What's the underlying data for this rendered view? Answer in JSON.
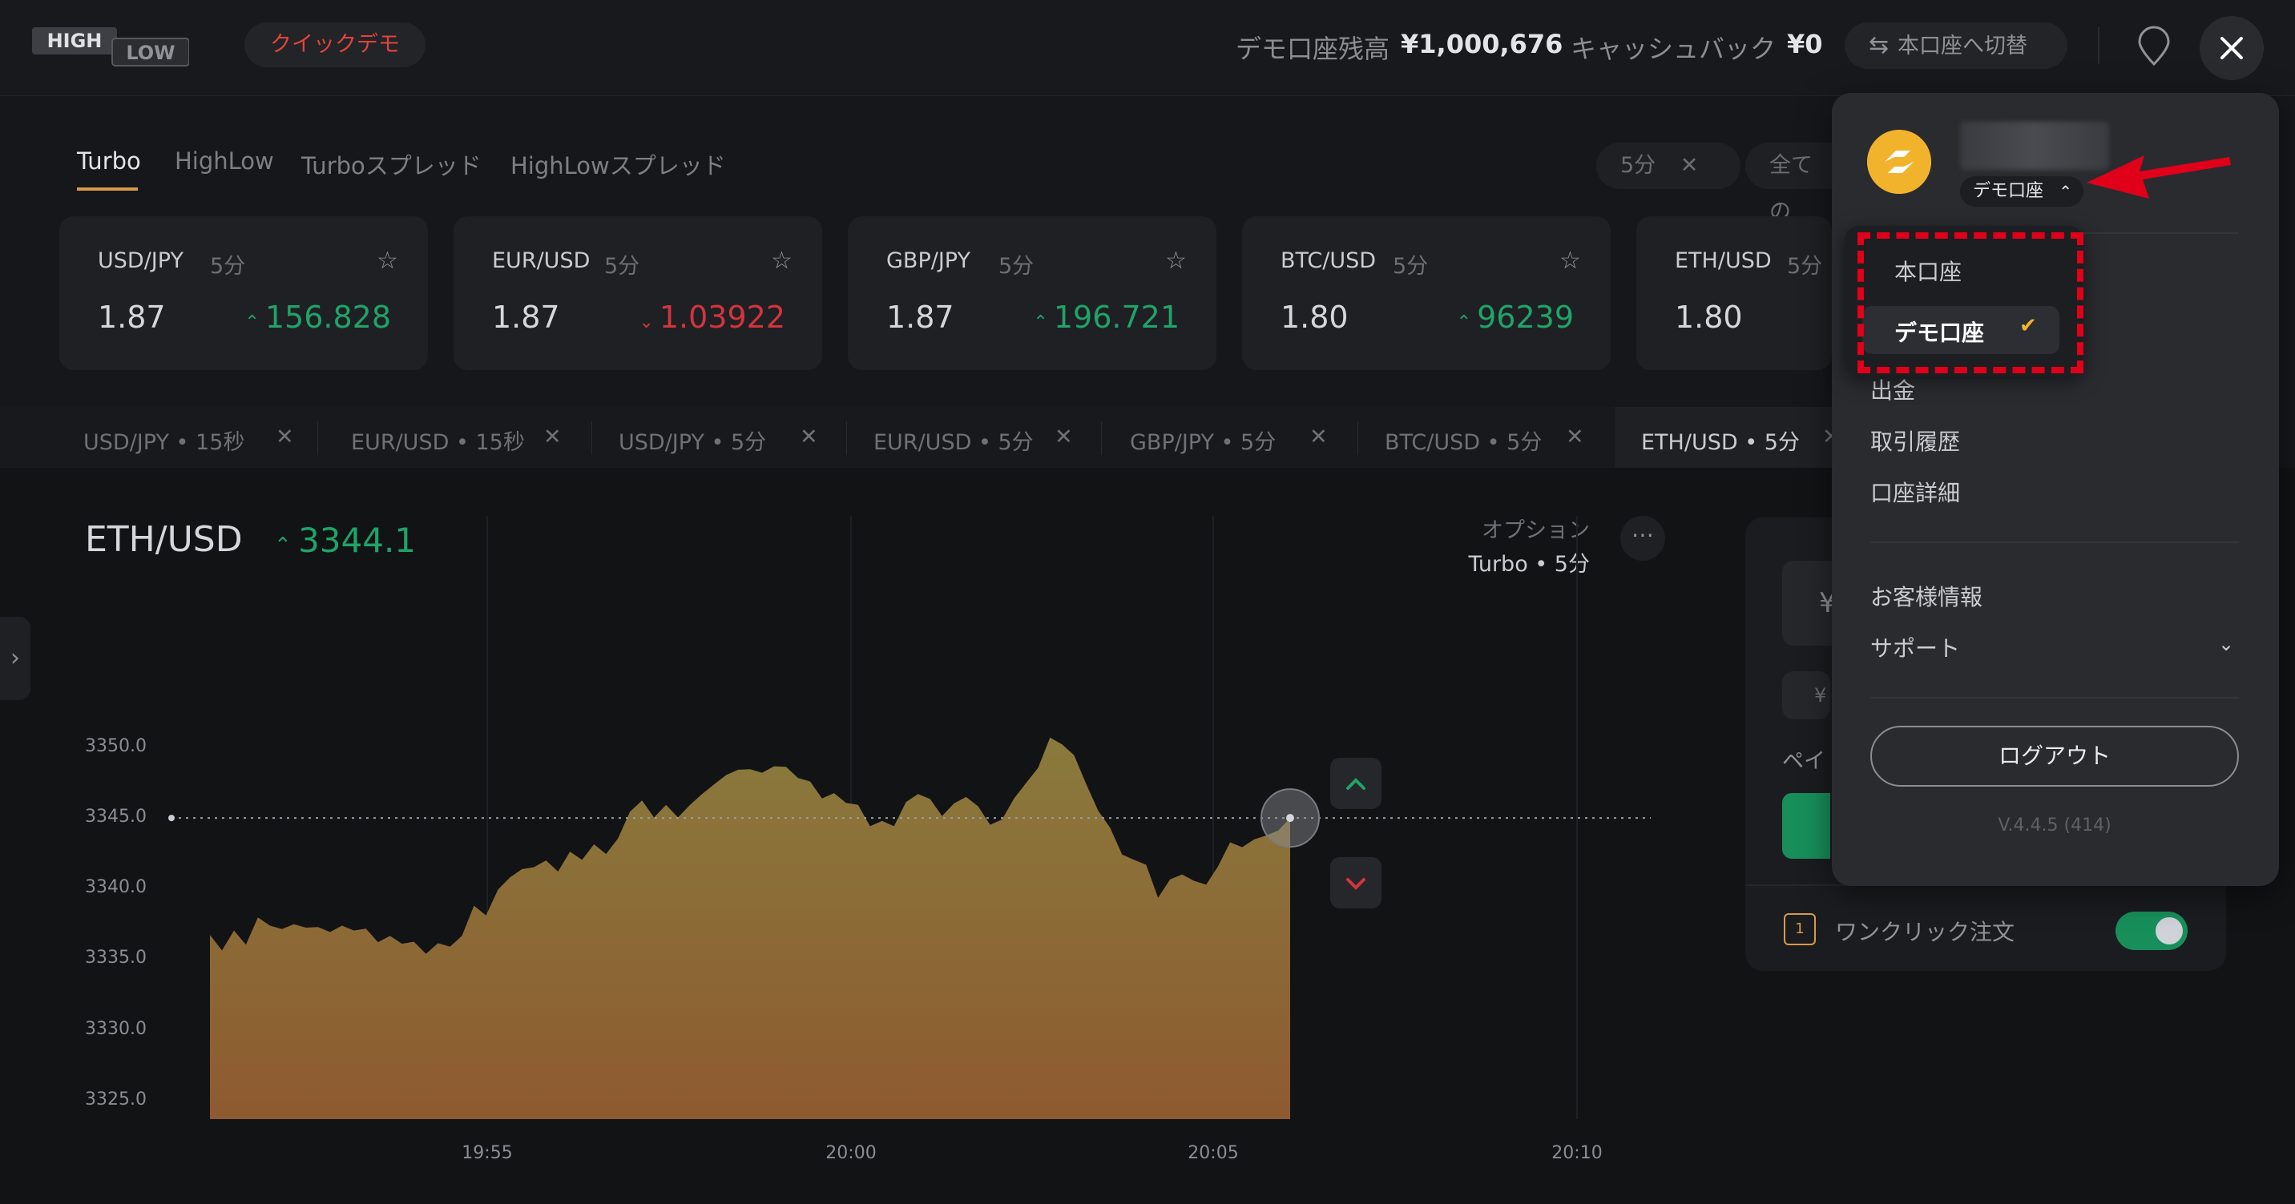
{
  "header": {
    "logo_top": "HIGH",
    "logo_bottom": "LOW",
    "quick_demo": "クイックデモ",
    "balance_label": "デモ口座残高",
    "balance_value": "¥1,000,676",
    "cashback_label": "キャッシュバック",
    "cashback_value": "¥0",
    "switch_label": "本口座へ切替",
    "icons": {
      "switch": "swap-arrows-icon",
      "pin": "location-pin-icon",
      "close": "close-icon"
    }
  },
  "product_tabs": [
    "Turbo",
    "HighLow",
    "Turboスプレッド",
    "HighLowスプレッド"
  ],
  "filters": {
    "duration": "5分",
    "all": "全ての"
  },
  "asset_cards": [
    {
      "pair": "USD/JPY",
      "duration": "5分",
      "payout": "1.87",
      "price": "156.828",
      "direction": "up"
    },
    {
      "pair": "EUR/USD",
      "duration": "5分",
      "payout": "1.87",
      "price": "1.03922",
      "direction": "down"
    },
    {
      "pair": "GBP/JPY",
      "duration": "5分",
      "payout": "1.87",
      "price": "196.721",
      "direction": "up"
    },
    {
      "pair": "BTC/USD",
      "duration": "5分",
      "payout": "1.80",
      "price": "96239",
      "direction": "up"
    },
    {
      "pair": "ETH/USD",
      "duration": "5分",
      "payout": "1.80",
      "price": "",
      "direction": "up"
    }
  ],
  "chart_tabs": [
    "USD/JPY • 15秒",
    "EUR/USD • 15秒",
    "USD/JPY • 5分",
    "EUR/USD • 5分",
    "GBP/JPY • 5分",
    "BTC/USD • 5分",
    "ETH/USD • 5分"
  ],
  "chart_header": {
    "title": "ETH/USD",
    "price": "3344.1",
    "option_label": "オプション",
    "option_value": "Turbo • 5分",
    "more": "⋯"
  },
  "chart_data": {
    "type": "area",
    "x_ticks": [
      "19:55",
      "20:00",
      "20:05",
      "20:10"
    ],
    "y_ticks": [
      "3350.0",
      "3345.0",
      "3340.0",
      "3335.0",
      "3330.0",
      "3325.0"
    ],
    "ylim": [
      3323.5,
      3352
    ],
    "current_price": 3344.1,
    "fill_top": "#8a7a3c",
    "fill_bottom": "#8e5a30",
    "values": [
      3336.1,
      3335.2,
      3336.4,
      3335.6,
      3337.3,
      3336.9,
      3336.5,
      3337.0,
      3336.6,
      3336.8,
      3336.3,
      3336.9,
      3336.4,
      3336.7,
      3335.6,
      3336.2,
      3335.5,
      3335.8,
      3334.8,
      3335.7,
      3335.3,
      3336.2,
      3338.1,
      3337.6,
      3339.2,
      3340.2,
      3340.6,
      3340.9,
      3341.2,
      3340.6,
      3341.8,
      3341.4,
      3342.3,
      3341.8,
      3342.7,
      3344.7,
      3345.3,
      3344.3,
      3345.0,
      3344.3,
      3345.0,
      3345.9,
      3346.4,
      3347.2,
      3347.4,
      3347.6,
      3347.2,
      3347.8,
      3347.6,
      3347.0,
      3346.6,
      3345.6,
      3345.8,
      3345.3,
      3345.0,
      3343.7,
      3343.9,
      3343.7,
      3345.2,
      3345.9,
      3345.4,
      3344.4,
      3345.1,
      3345.7,
      3344.9,
      3343.8,
      3344.0,
      3345.6,
      3346.5,
      3347.7,
      3349.6,
      3349.3,
      3348.4,
      3346.6,
      3344.6,
      3343.6,
      3341.6,
      3341.4,
      3340.9,
      3338.8,
      3339.9,
      3340.4,
      3339.8,
      3339.7,
      3340.8,
      3342.6,
      3342.1,
      3342.8,
      3342.9,
      3343.4,
      3344.1
    ],
    "buttons": {
      "up": "chevron-up-icon",
      "down": "chevron-down-icon"
    }
  },
  "trade_panel": {
    "amount_prefix": "¥",
    "small_prefix": "¥",
    "payout_label": "ペイ",
    "oneclick_label": "ワンクリック注文",
    "oneclick_icon": "1"
  },
  "account_menu": {
    "account_type": "デモ口座",
    "dropdown_options": [
      "本口座",
      "デモ口座"
    ],
    "selected_option": "デモ口座",
    "items": [
      "出金",
      "取引履歴",
      "口座詳細",
      "お客様情報",
      "サポート"
    ],
    "logout": "ログアウト",
    "version": "V.4.4.5 (414)"
  },
  "colors": {
    "accent": "#d89b47",
    "up": "#1fa36a",
    "down": "#d2343e",
    "annotation": "#e0001a",
    "avatar": "#f2b32c"
  }
}
